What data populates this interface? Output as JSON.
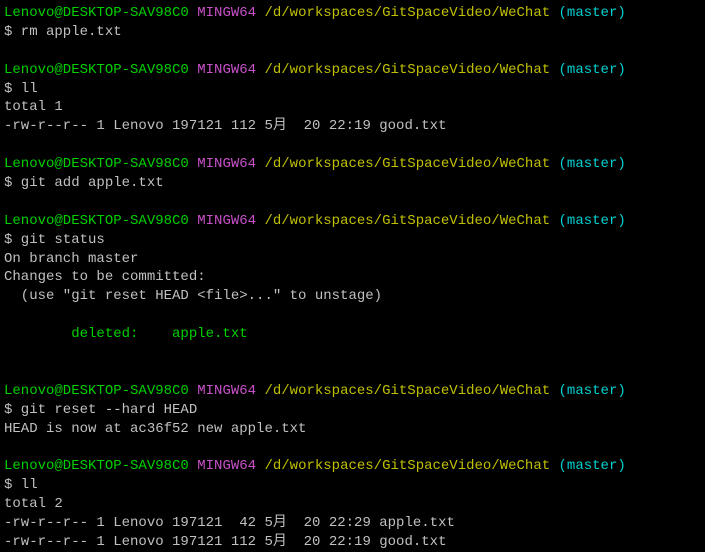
{
  "prompt": {
    "userHost": "Lenovo@DESKTOP-SAV98C0",
    "mingw": "MINGW64",
    "path": "/d/workspaces/GitSpaceVideo/WeChat",
    "branch": "(master)"
  },
  "block1": {
    "cmd": "$ rm apple.txt"
  },
  "block2": {
    "cmd": "$ ll",
    "out1": "total 1",
    "out2": "-rw-r--r-- 1 Lenovo 197121 112 5月  20 22:19 good.txt"
  },
  "block3": {
    "cmd": "$ git add apple.txt"
  },
  "block4": {
    "cmd": "$ git status",
    "out1": "On branch master",
    "out2": "Changes to be committed:",
    "out3": "  (use \"git reset HEAD <file>...\" to unstage)",
    "out4": "        deleted:    apple.txt"
  },
  "block5": {
    "cmd": "$ git reset --hard HEAD",
    "out1": "HEAD is now at ac36f52 new apple.txt"
  },
  "block6": {
    "cmd": "$ ll",
    "out1": "total 2",
    "out2": "-rw-r--r-- 1 Lenovo 197121  42 5月  20 22:29 apple.txt",
    "out3": "-rw-r--r-- 1 Lenovo 197121 112 5月  20 22:19 good.txt"
  }
}
